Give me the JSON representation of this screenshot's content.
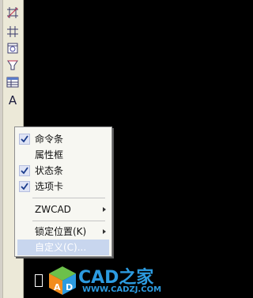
{
  "toolbar": {
    "icons": [
      "construction-line-icon",
      "construction-line-2-icon",
      "insert-block-icon",
      "make-block-icon",
      "table-icon",
      "multiline-text-icon"
    ],
    "text_tool_letter": "A"
  },
  "context_menu": {
    "items": [
      {
        "label": "命令条",
        "checked": true
      },
      {
        "label": "属性框",
        "checked": false
      },
      {
        "label": "状态条",
        "checked": true
      },
      {
        "label": "选项卡",
        "checked": true
      }
    ],
    "zwcad_label": "ZWCAD",
    "lock_label": "锁定位置(K)",
    "customize_label": "自定义(C)..."
  },
  "watermark": {
    "title": "CAD之家",
    "url": "WWW.CADZJ.COM",
    "colors": {
      "text": "#2c9be0",
      "cube_orange": "#f28c1c",
      "cube_green": "#6cc04a",
      "cube_blue": "#2c9be0"
    }
  },
  "colors": {
    "background": "#000000",
    "toolbar": "#ece9d8",
    "menu_bg": "#f7f7f2",
    "menu_hover": "#c8d6ee"
  }
}
